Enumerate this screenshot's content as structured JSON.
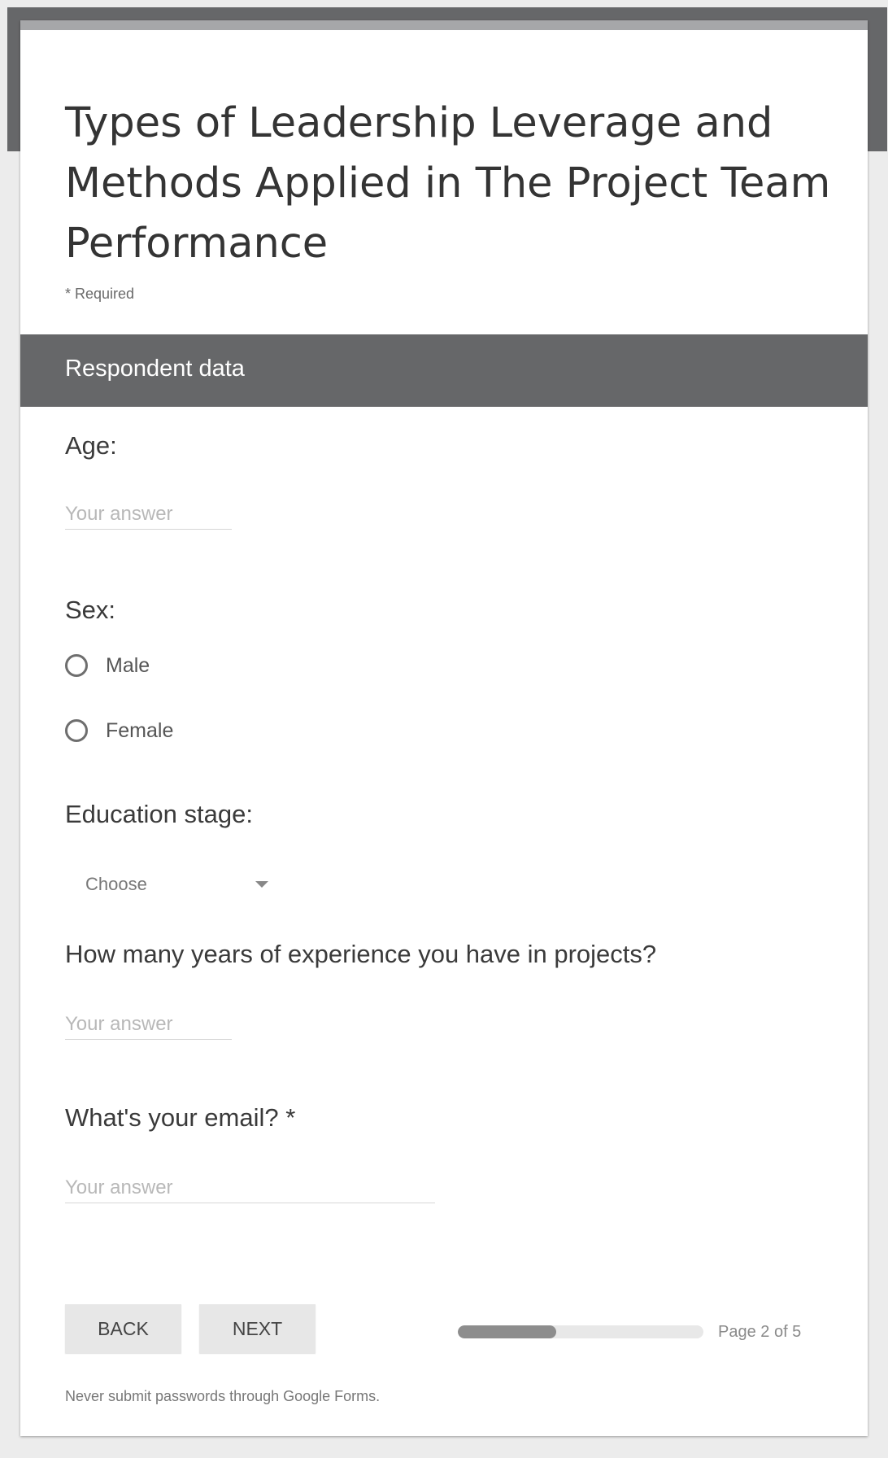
{
  "form": {
    "title": "Types of Leadership Leverage and Methods Applied in The Project Team Performance",
    "required_note": "* Required"
  },
  "section": {
    "title": "Respondent data"
  },
  "questions": {
    "age": {
      "label": "Age:",
      "placeholder": "Your answer",
      "value": ""
    },
    "sex": {
      "label": "Sex:",
      "options": [
        "Male",
        "Female"
      ],
      "selected": null
    },
    "education": {
      "label": "Education stage:",
      "selected_value": "Choose"
    },
    "experience": {
      "label": "How many years of experience you have in projects?",
      "placeholder": "Your answer",
      "value": ""
    },
    "email": {
      "label": "What's your email? *",
      "placeholder": "Your answer",
      "value": ""
    }
  },
  "navigation": {
    "back_label": "BACK",
    "next_label": "NEXT",
    "page_indicator": "Page 2 of 5",
    "progress_fraction": 0.4
  },
  "footer": {
    "note": "Never submit passwords through Google Forms."
  },
  "icons": {
    "dropdown": "chevron-down-icon",
    "radio": "radio-unchecked-icon"
  },
  "colors": {
    "header_band": "#666769",
    "page_background": "#ececec",
    "card_background": "#ffffff",
    "progress_fill": "#8d8d8d",
    "progress_track": "#e8e8e8"
  }
}
